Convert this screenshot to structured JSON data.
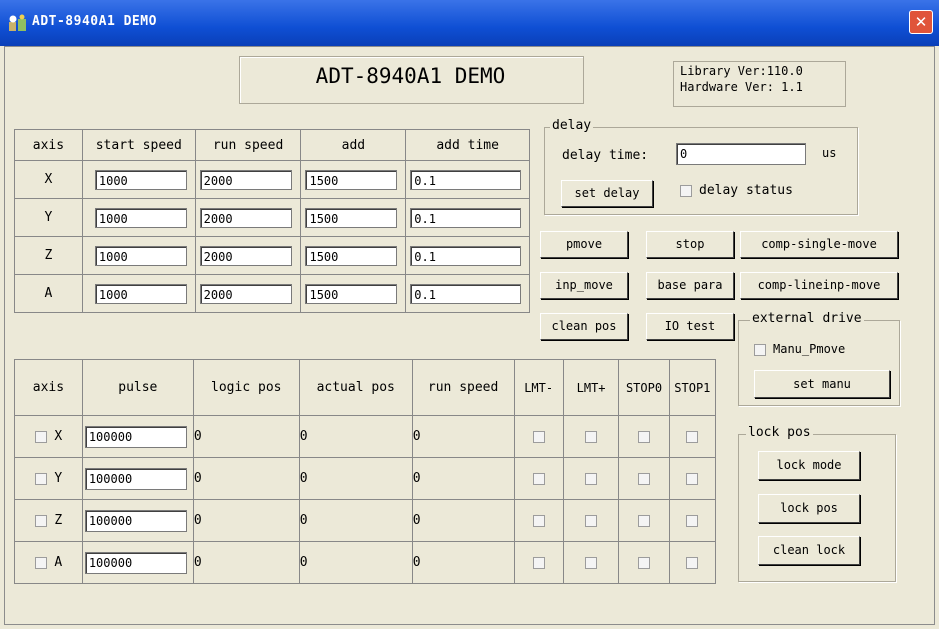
{
  "window": {
    "title": "ADT-8940A1 DEMO",
    "close_glyph": "✕"
  },
  "banner": {
    "title": "ADT-8940A1 DEMO"
  },
  "version": {
    "text": "Library Ver:110.0\nHardware Ver: 1.1"
  },
  "speed_table": {
    "headers": [
      "axis",
      "start speed",
      "run speed",
      "add",
      "add time"
    ],
    "rows": [
      {
        "axis": "X",
        "start": "1000",
        "run": "2000",
        "add": "1500",
        "add_time": "0.1"
      },
      {
        "axis": "Y",
        "start": "1000",
        "run": "2000",
        "add": "1500",
        "add_time": "0.1"
      },
      {
        "axis": "Z",
        "start": "1000",
        "run": "2000",
        "add": "1500",
        "add_time": "0.1"
      },
      {
        "axis": "A",
        "start": "1000",
        "run": "2000",
        "add": "1500",
        "add_time": "0.1"
      }
    ]
  },
  "delay": {
    "legend": "delay",
    "label": "delay time:",
    "value": "0",
    "unit": "us",
    "set_button": "set delay",
    "status_label": "delay status"
  },
  "buttons": {
    "pmove": "pmove",
    "stop": "stop",
    "comp_single": "comp-single-move",
    "inp_move": "inp_move",
    "base_para": "base para",
    "comp_lineinp": "comp-lineinp-move",
    "clean_pos": "clean pos",
    "io_test": "IO test"
  },
  "external_drive": {
    "legend": "external drive",
    "manu_label": "Manu_Pmove",
    "set_button": "set manu"
  },
  "lock": {
    "legend": "lock pos",
    "mode_button": "lock mode",
    "pos_button": "lock pos",
    "clean_button": "clean lock"
  },
  "pos_table": {
    "headers": [
      "axis",
      "pulse",
      "logic pos",
      "actual pos",
      "run speed",
      "LMT-",
      "LMT+",
      "STOP0",
      "STOP1"
    ],
    "rows": [
      {
        "axis": "X",
        "pulse": "100000",
        "logic": "0",
        "actual": "0",
        "speed": "0"
      },
      {
        "axis": "Y",
        "pulse": "100000",
        "logic": "0",
        "actual": "0",
        "speed": "0"
      },
      {
        "axis": "Z",
        "pulse": "100000",
        "logic": "0",
        "actual": "0",
        "speed": "0"
      },
      {
        "axis": "A",
        "pulse": "100000",
        "logic": "0",
        "actual": "0",
        "speed": "0"
      }
    ]
  }
}
